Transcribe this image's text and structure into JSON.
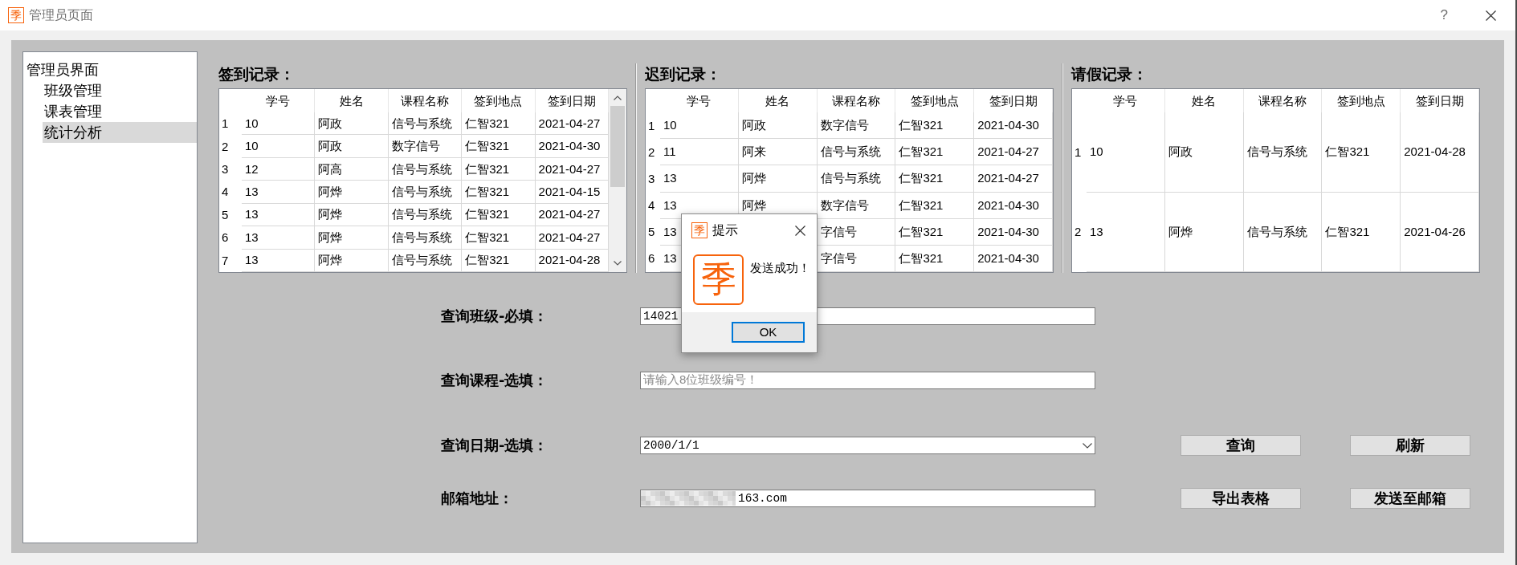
{
  "window": {
    "logo": "季",
    "title": "管理员页面",
    "help": "?"
  },
  "sidebar": {
    "items": [
      {
        "label": "管理员界面",
        "selected": false,
        "children": [
          {
            "label": "班级管理",
            "selected": false
          },
          {
            "label": "课表管理",
            "selected": false
          },
          {
            "label": "统计分析",
            "selected": true
          }
        ]
      }
    ]
  },
  "tables": [
    {
      "title": "签到记录：",
      "scrollbar": true,
      "columns": [
        "学号",
        "姓名",
        "课程名称",
        "签到地点",
        "签到日期"
      ],
      "rows": [
        {
          "number": "1",
          "student_id": "10",
          "name": "阿政",
          "course": "信号与系统",
          "location": "仁智321",
          "date": "2021-04-27"
        },
        {
          "number": "2",
          "student_id": "10",
          "name": "阿政",
          "course": "数字信号",
          "location": "仁智321",
          "date": "2021-04-30"
        },
        {
          "number": "3",
          "student_id": "12",
          "name": "阿高",
          "course": "信号与系统",
          "location": "仁智321",
          "date": "2021-04-27"
        },
        {
          "number": "4",
          "student_id": "13",
          "name": "阿烨",
          "course": "信号与系统",
          "location": "仁智321",
          "date": "2021-04-15"
        },
        {
          "number": "5",
          "student_id": "13",
          "name": "阿烨",
          "course": "信号与系统",
          "location": "仁智321",
          "date": "2021-04-27"
        },
        {
          "number": "6",
          "student_id": "13",
          "name": "阿烨",
          "course": "信号与系统",
          "location": "仁智321",
          "date": "2021-04-27"
        },
        {
          "number": "7",
          "student_id": "13",
          "name": "阿烨",
          "course": "信号与系统",
          "location": "仁智321",
          "date": "2021-04-28"
        }
      ]
    },
    {
      "title": "迟到记录：",
      "columns": [
        "学号",
        "姓名",
        "课程名称",
        "签到地点",
        "签到日期"
      ],
      "rows": [
        {
          "number": "1",
          "student_id": "10",
          "name": "阿政",
          "course": "数字信号",
          "location": "仁智321",
          "date": "2021-04-30"
        },
        {
          "number": "2",
          "student_id": "11",
          "name": "阿来",
          "course": "信号与系统",
          "location": "仁智321",
          "date": "2021-04-27"
        },
        {
          "number": "3",
          "student_id": "13",
          "name": "阿烨",
          "course": "信号与系统",
          "location": "仁智321",
          "date": "2021-04-27"
        },
        {
          "number": "4",
          "student_id": "13",
          "name": "阿烨",
          "course": "数字信号",
          "location": "仁智321",
          "date": "2021-04-30"
        },
        {
          "number": "5",
          "student_id": "13",
          "course": "字信号",
          "location": "仁智321",
          "date": "2021-04-30"
        },
        {
          "number": "6",
          "student_id": "13",
          "course": "字信号",
          "location": "仁智321",
          "date": "2021-04-30"
        }
      ]
    },
    {
      "title": "请假记录：",
      "columns": [
        "学号",
        "姓名",
        "课程名称",
        "签到地点",
        "签到日期"
      ],
      "rows": [
        {
          "number": "1",
          "student_id": "10",
          "name": "阿政",
          "course": "信号与系统",
          "location": "仁智321",
          "date": "2021-04-28"
        },
        {
          "number": "2",
          "student_id": "13",
          "name": "阿烨",
          "course": "信号与系统",
          "location": "仁智321",
          "date": "2021-04-26"
        }
      ]
    }
  ],
  "form": {
    "fields": [
      {
        "label": "查询班级-必填：",
        "kind": "text",
        "value": "14021"
      },
      {
        "label": "查询课程-选填：",
        "kind": "text",
        "placeholder": "请输入8位班级编号！"
      },
      {
        "label": "查询日期-选填：",
        "kind": "dropdown",
        "value": "2000/1/1"
      },
      {
        "label": "邮箱地址：",
        "kind": "text",
        "redacted": true,
        "value": "163.com"
      }
    ],
    "buttons": [
      "查询",
      "刷新",
      "导出表格",
      "发送至邮箱"
    ]
  },
  "dialog": {
    "logo": "季",
    "title": "提示",
    "icon": "季",
    "message": "发送成功！",
    "button": "OK"
  }
}
